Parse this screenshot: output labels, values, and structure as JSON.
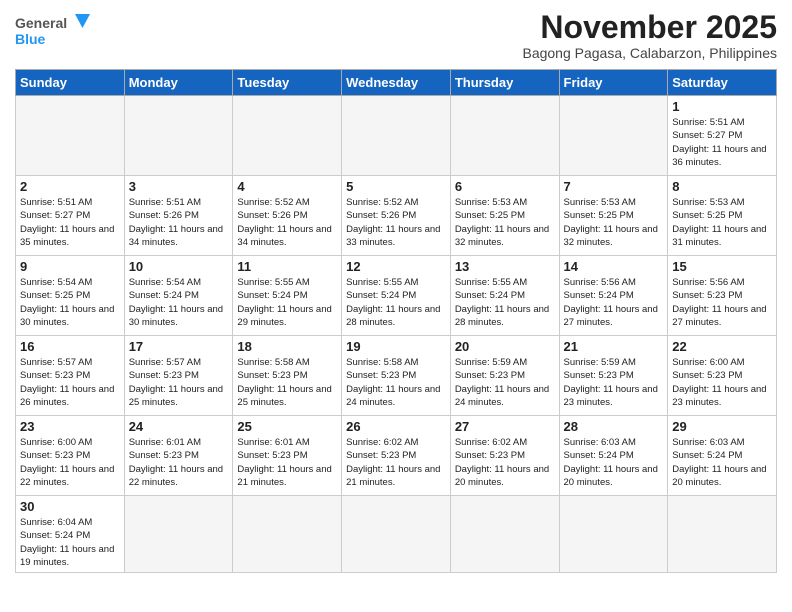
{
  "logo": {
    "general": "General",
    "blue": "Blue"
  },
  "title": "November 2025",
  "location": "Bagong Pagasa, Calabarzon, Philippines",
  "days": [
    "Sunday",
    "Monday",
    "Tuesday",
    "Wednesday",
    "Thursday",
    "Friday",
    "Saturday"
  ],
  "weeks": [
    [
      {
        "day": "",
        "info": ""
      },
      {
        "day": "",
        "info": ""
      },
      {
        "day": "",
        "info": ""
      },
      {
        "day": "",
        "info": ""
      },
      {
        "day": "",
        "info": ""
      },
      {
        "day": "",
        "info": ""
      },
      {
        "day": "1",
        "info": "Sunrise: 5:51 AM\nSunset: 5:27 PM\nDaylight: 11 hours\nand 36 minutes."
      }
    ],
    [
      {
        "day": "2",
        "info": "Sunrise: 5:51 AM\nSunset: 5:27 PM\nDaylight: 11 hours\nand 35 minutes."
      },
      {
        "day": "3",
        "info": "Sunrise: 5:51 AM\nSunset: 5:26 PM\nDaylight: 11 hours\nand 34 minutes."
      },
      {
        "day": "4",
        "info": "Sunrise: 5:52 AM\nSunset: 5:26 PM\nDaylight: 11 hours\nand 34 minutes."
      },
      {
        "day": "5",
        "info": "Sunrise: 5:52 AM\nSunset: 5:26 PM\nDaylight: 11 hours\nand 33 minutes."
      },
      {
        "day": "6",
        "info": "Sunrise: 5:53 AM\nSunset: 5:25 PM\nDaylight: 11 hours\nand 32 minutes."
      },
      {
        "day": "7",
        "info": "Sunrise: 5:53 AM\nSunset: 5:25 PM\nDaylight: 11 hours\nand 32 minutes."
      },
      {
        "day": "8",
        "info": "Sunrise: 5:53 AM\nSunset: 5:25 PM\nDaylight: 11 hours\nand 31 minutes."
      }
    ],
    [
      {
        "day": "9",
        "info": "Sunrise: 5:54 AM\nSunset: 5:25 PM\nDaylight: 11 hours\nand 30 minutes."
      },
      {
        "day": "10",
        "info": "Sunrise: 5:54 AM\nSunset: 5:24 PM\nDaylight: 11 hours\nand 30 minutes."
      },
      {
        "day": "11",
        "info": "Sunrise: 5:55 AM\nSunset: 5:24 PM\nDaylight: 11 hours\nand 29 minutes."
      },
      {
        "day": "12",
        "info": "Sunrise: 5:55 AM\nSunset: 5:24 PM\nDaylight: 11 hours\nand 28 minutes."
      },
      {
        "day": "13",
        "info": "Sunrise: 5:55 AM\nSunset: 5:24 PM\nDaylight: 11 hours\nand 28 minutes."
      },
      {
        "day": "14",
        "info": "Sunrise: 5:56 AM\nSunset: 5:24 PM\nDaylight: 11 hours\nand 27 minutes."
      },
      {
        "day": "15",
        "info": "Sunrise: 5:56 AM\nSunset: 5:23 PM\nDaylight: 11 hours\nand 27 minutes."
      }
    ],
    [
      {
        "day": "16",
        "info": "Sunrise: 5:57 AM\nSunset: 5:23 PM\nDaylight: 11 hours\nand 26 minutes."
      },
      {
        "day": "17",
        "info": "Sunrise: 5:57 AM\nSunset: 5:23 PM\nDaylight: 11 hours\nand 25 minutes."
      },
      {
        "day": "18",
        "info": "Sunrise: 5:58 AM\nSunset: 5:23 PM\nDaylight: 11 hours\nand 25 minutes."
      },
      {
        "day": "19",
        "info": "Sunrise: 5:58 AM\nSunset: 5:23 PM\nDaylight: 11 hours\nand 24 minutes."
      },
      {
        "day": "20",
        "info": "Sunrise: 5:59 AM\nSunset: 5:23 PM\nDaylight: 11 hours\nand 24 minutes."
      },
      {
        "day": "21",
        "info": "Sunrise: 5:59 AM\nSunset: 5:23 PM\nDaylight: 11 hours\nand 23 minutes."
      },
      {
        "day": "22",
        "info": "Sunrise: 6:00 AM\nSunset: 5:23 PM\nDaylight: 11 hours\nand 23 minutes."
      }
    ],
    [
      {
        "day": "23",
        "info": "Sunrise: 6:00 AM\nSunset: 5:23 PM\nDaylight: 11 hours\nand 22 minutes."
      },
      {
        "day": "24",
        "info": "Sunrise: 6:01 AM\nSunset: 5:23 PM\nDaylight: 11 hours\nand 22 minutes."
      },
      {
        "day": "25",
        "info": "Sunrise: 6:01 AM\nSunset: 5:23 PM\nDaylight: 11 hours\nand 21 minutes."
      },
      {
        "day": "26",
        "info": "Sunrise: 6:02 AM\nSunset: 5:23 PM\nDaylight: 11 hours\nand 21 minutes."
      },
      {
        "day": "27",
        "info": "Sunrise: 6:02 AM\nSunset: 5:23 PM\nDaylight: 11 hours\nand 20 minutes."
      },
      {
        "day": "28",
        "info": "Sunrise: 6:03 AM\nSunset: 5:24 PM\nDaylight: 11 hours\nand 20 minutes."
      },
      {
        "day": "29",
        "info": "Sunrise: 6:03 AM\nSunset: 5:24 PM\nDaylight: 11 hours\nand 20 minutes."
      }
    ],
    [
      {
        "day": "30",
        "info": "Sunrise: 6:04 AM\nSunset: 5:24 PM\nDaylight: 11 hours\nand 19 minutes."
      },
      {
        "day": "",
        "info": ""
      },
      {
        "day": "",
        "info": ""
      },
      {
        "day": "",
        "info": ""
      },
      {
        "day": "",
        "info": ""
      },
      {
        "day": "",
        "info": ""
      },
      {
        "day": "",
        "info": ""
      }
    ]
  ]
}
